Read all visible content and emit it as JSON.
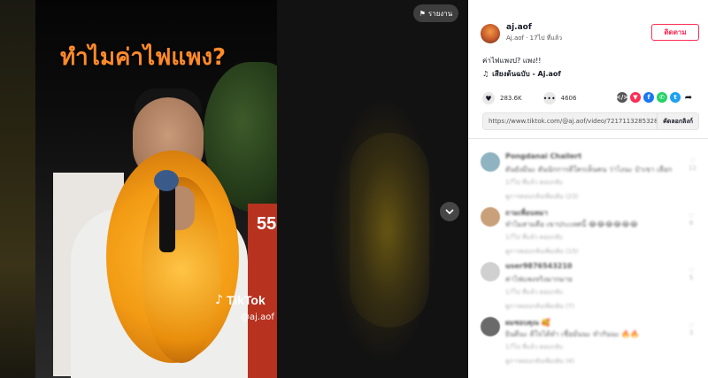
{
  "video": {
    "caption": "ทำไมค่าไฟแพง?",
    "watermark": "TikTok",
    "watermark_user": "@aj.aof",
    "banner_text": "55",
    "report_label": "รายงาน"
  },
  "author": {
    "username": "aj.aof",
    "display": "Aj.aof · 17ไป ที่แล้ว",
    "follow_label": "ติดตาม"
  },
  "post": {
    "description": "ค่าไฟแพงป? แพง!!",
    "music": "เสียงต้นฉบับ - Aj.aof",
    "likes": "283.6K",
    "comments": "4606",
    "link": "https://www.tiktok.com/@aj.aof/video/721711328532847...",
    "copy_label": "คัดลอกลิงก์"
  },
  "share_icons": [
    {
      "name": "embed-icon",
      "glyph": "</>",
      "color": "#555555"
    },
    {
      "name": "send-icon",
      "glyph": "▼",
      "color": "#fe2c55"
    },
    {
      "name": "facebook-icon",
      "glyph": "f",
      "color": "#1877f2"
    },
    {
      "name": "whatsapp-icon",
      "glyph": "✆",
      "color": "#25d366"
    },
    {
      "name": "twitter-icon",
      "glyph": "t",
      "color": "#1da1f2"
    },
    {
      "name": "share-arrow-icon",
      "glyph": "➦",
      "color": "#161823"
    }
  ],
  "comment_list": [
    {
      "name": "Pongdanai Chailert",
      "text": "ดันยังมีนะ ดันนักการดีใครเห็นคน ว่าไงนะ ป๋าเขา เลือก",
      "meta": "17ไป ที่แล้ว    ตอบกลับ",
      "likes": "12",
      "replies": "ดูการตอบกลับเพิ่มเติม (23)"
    },
    {
      "name": "ถามเพื่อนหมา",
      "text": "ทำไมสามคือ เขาประเทศนี้ 😂😂😂😂😂😂",
      "meta": "17ไป ที่แล้ว    ตอบกลับ",
      "likes": "8",
      "replies": "ดูการตอบกลับเพิ่มเติม (15)"
    },
    {
      "name": "user9876543210",
      "text": "ค่าไฟแพงจริงมากมาย",
      "meta": "17ไป ที่แล้ว    ตอบกลับ",
      "likes": "5",
      "replies": "ดูการตอบกลับเพิ่มเติม (7)"
    },
    {
      "name": "ผมชอบคุณ 🥰",
      "text": "ยินดีนะ ดีใจได้ทำ เชื่อมั่นนะ ทำกันนะ 🔥🔥",
      "meta": "17ไป ที่แล้ว    ตอบกลับ",
      "likes": "3",
      "replies": "ดูการตอบกลับเพิ่มเติม (4)"
    }
  ]
}
